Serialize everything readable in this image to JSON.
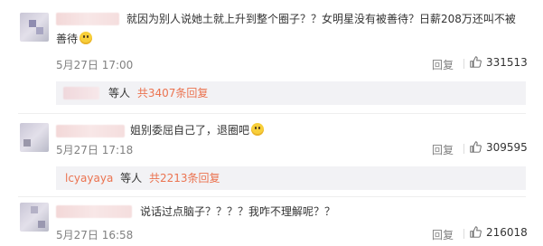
{
  "comments": [
    {
      "text_line1": "就因为别人说她土就上升到整个圈子？？女明星没有被善待？日薪208万还叫不被",
      "text_line2": "善待",
      "time": "5月27日 17:00",
      "reply_label": "回复",
      "likes": "331513",
      "replies": {
        "user": "",
        "mid": "等人",
        "count": "共3407条回复"
      }
    },
    {
      "text_line1": "姐别委屈自己了，退圈吧",
      "time": "5月27日 17:18",
      "reply_label": "回复",
      "likes": "309595",
      "replies": {
        "user": "lcyayaya",
        "mid": "等人",
        "count": "共2213条回复"
      }
    },
    {
      "text_line1": "说话过点脑子？？？？我咋不理解呢？？",
      "time": "5月27日 16:58",
      "reply_label": "回复",
      "likes": "216018"
    }
  ],
  "icons": {
    "like": "thumbs-up-icon",
    "emoji": "emoji-face-icon"
  },
  "colors": {
    "link": "#eb7350",
    "meta": "#808080",
    "reply_bg": "#f2f2f5"
  }
}
